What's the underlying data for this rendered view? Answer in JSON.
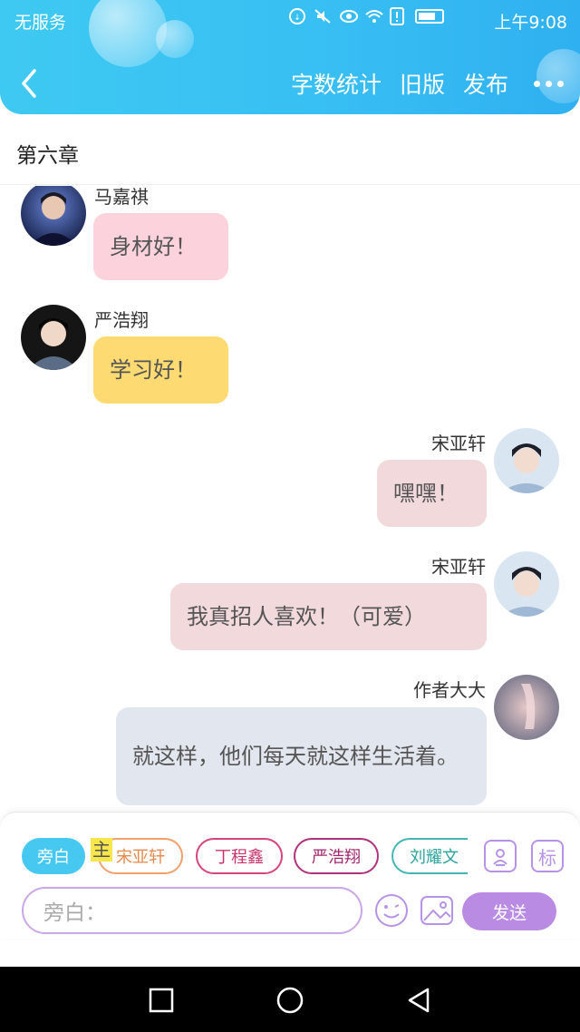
{
  "status_bar": {
    "carrier": "无服务",
    "time": "上午9:08"
  },
  "header": {
    "back_icon": "chevron-left-icon",
    "actions": {
      "word_count": "字数统计",
      "old_version": "旧版",
      "publish": "发布"
    },
    "more_icon": "more-dots-icon"
  },
  "chapter": {
    "title": "第六章"
  },
  "messages": [
    {
      "name": "马嘉祺",
      "text": "身材好！",
      "side": "left",
      "bubble_color": "#fcd3dc"
    },
    {
      "name": "严浩翔",
      "text": "学习好！",
      "side": "left",
      "bubble_color": "#fddb72"
    },
    {
      "name": "宋亚轩",
      "text": "嘿嘿！",
      "side": "right",
      "bubble_color": "#f2d9dc"
    },
    {
      "name": "宋亚轩",
      "text": "我真招人喜欢！（可爱）",
      "side": "right",
      "bubble_color": "#f2d9dc"
    },
    {
      "name": "作者大大",
      "text": "就这样，他们每天就这样生活着。",
      "side": "right",
      "bubble_color": "#e2e6ee"
    }
  ],
  "compose": {
    "master_tag": "主",
    "roles": [
      {
        "label": "旁白",
        "style": "active"
      },
      {
        "label": "宋亚轩",
        "style": "orange"
      },
      {
        "label": "丁程鑫",
        "style": "crimson"
      },
      {
        "label": "严浩翔",
        "style": "magenta"
      },
      {
        "label": "刘耀文",
        "style": "teal"
      }
    ],
    "role_manage_icon": "contact-card-icon",
    "tag_button_label": "标",
    "input_placeholder": "旁白：",
    "emoji_icon": "emoji-icon",
    "image_icon": "image-icon",
    "send_label": "发送"
  },
  "colors": {
    "header": "#3ec9f2",
    "accent_purple": "#b98be3",
    "active_chip": "#46c8f0"
  },
  "system_nav": {
    "icons": [
      "square-recent-icon",
      "circle-home-icon",
      "triangle-back-icon"
    ]
  }
}
